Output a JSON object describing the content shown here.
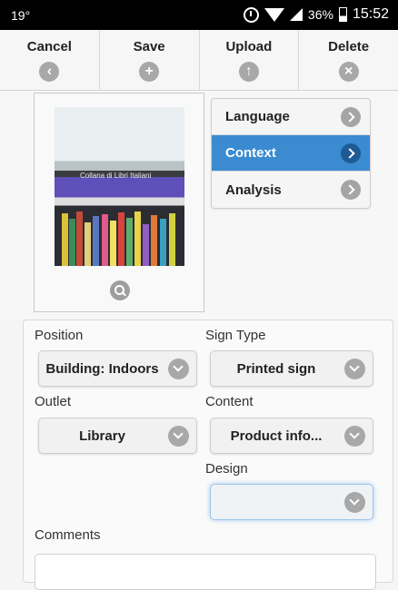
{
  "status_bar": {
    "temperature": "19°",
    "battery": "36%",
    "time": "15:52"
  },
  "toolbar": {
    "cancel_label": "Cancel",
    "save_label": "Save",
    "upload_label": "Upload",
    "delete_label": "Delete"
  },
  "photo": {
    "banner_text": "Collana di Libri Italiani"
  },
  "menu": {
    "items": [
      {
        "label": "Language"
      },
      {
        "label": "Context"
      },
      {
        "label": "Analysis"
      }
    ],
    "active": "Context"
  },
  "form": {
    "position": {
      "label": "Position",
      "value": "Building: Indoors"
    },
    "sign_type": {
      "label": "Sign Type",
      "value": "Printed sign"
    },
    "outlet": {
      "label": "Outlet",
      "value": "Library"
    },
    "content": {
      "label": "Content",
      "value": "Product info..."
    },
    "design": {
      "label": "Design",
      "value": ""
    },
    "comments": {
      "label": "Comments",
      "value": ""
    }
  },
  "colors": {
    "accent": "#3a8bd0",
    "accent_dark": "#1f5a94",
    "icon_gray": "#a8a8a8"
  }
}
